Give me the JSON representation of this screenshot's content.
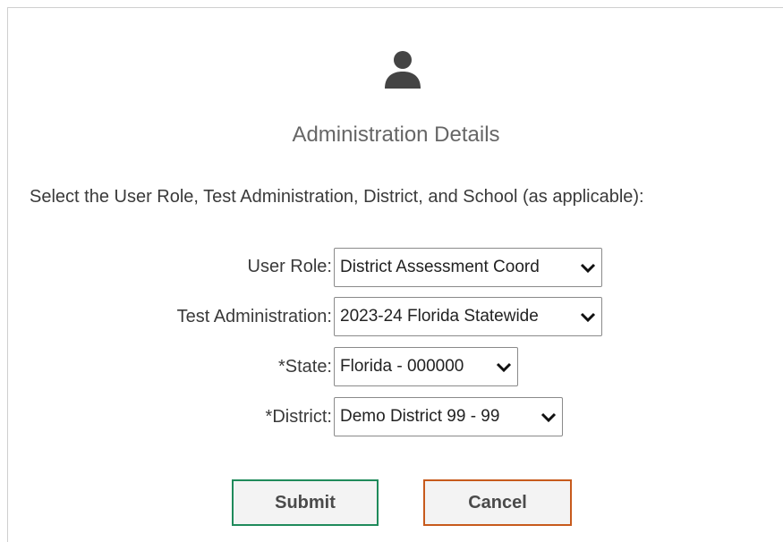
{
  "title": "Administration Details",
  "instructions": "Select the User Role, Test Administration, District, and School (as applicable):",
  "fields": [
    {
      "label": "User Role:",
      "value": "District Assessment Coord"
    },
    {
      "label": "Test Administration:",
      "value": "2023-24 Florida Statewide"
    },
    {
      "label": "*State:",
      "value": "Florida - 000000"
    },
    {
      "label": "*District:",
      "value": "Demo District 99 - 99"
    }
  ],
  "buttons": {
    "submit": "Submit",
    "cancel": "Cancel"
  },
  "icons": {
    "header": "user-icon",
    "dropdown": "chevron-down-icon"
  },
  "colors": {
    "submit_border": "#1f8a5b",
    "cancel_border": "#c75a1c",
    "title_text": "#666666"
  }
}
